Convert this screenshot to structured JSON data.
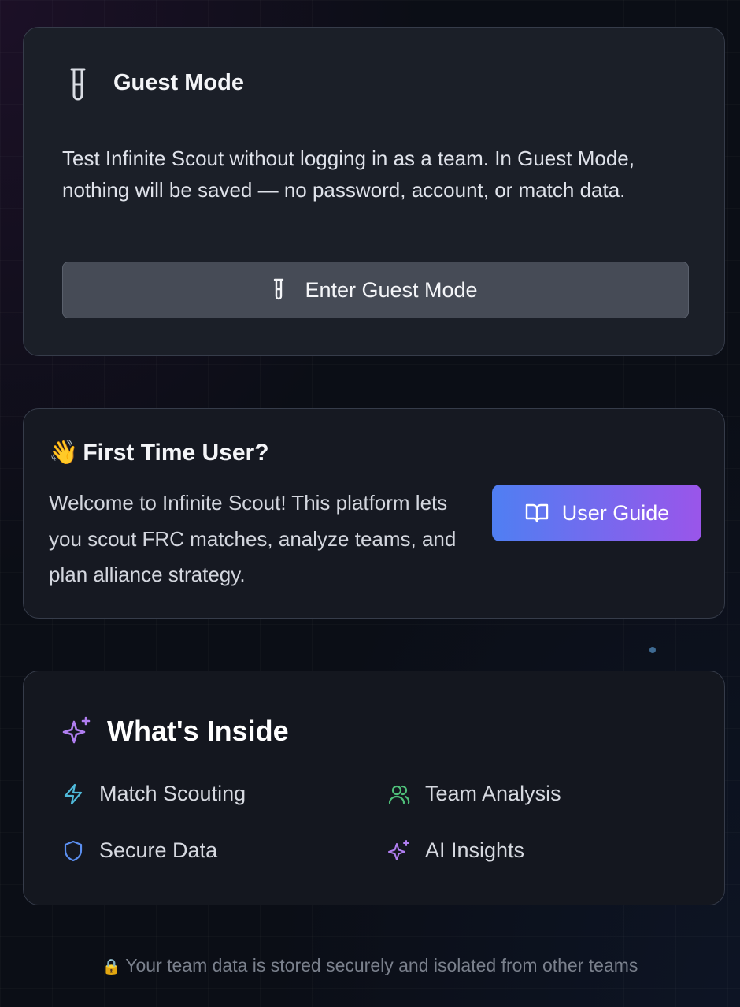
{
  "guest": {
    "title": "Guest Mode",
    "icon": "test-tube-icon",
    "description": "Test Infinite Scout without logging in as a team. In Guest Mode, nothing will be saved — no password, account, or match data.",
    "button_label": "Enter Guest Mode"
  },
  "first_time": {
    "emoji": "👋",
    "title": "First Time User?",
    "description": "Welcome to Infinite Scout! This platform lets you scout FRC matches, analyze teams, and plan alliance strategy.",
    "button_label": "User Guide",
    "button_icon": "book-open-icon",
    "button_gradient": [
      "#4f7ff2",
      "#9a55ea"
    ]
  },
  "inside": {
    "title": "What's Inside",
    "icon": "sparkles-icon",
    "features": [
      {
        "label": "Match Scouting",
        "icon": "lightning-icon",
        "color": "#4fb9d9"
      },
      {
        "label": "Team Analysis",
        "icon": "users-icon",
        "color": "#4fc07a"
      },
      {
        "label": "Secure Data",
        "icon": "shield-icon",
        "color": "#5b8ff0"
      },
      {
        "label": "AI Insights",
        "icon": "sparkles-icon",
        "color": "#b07ef0"
      }
    ]
  },
  "footer": {
    "lock": "🔒",
    "text": "Your team data is stored securely and isolated from other teams"
  }
}
